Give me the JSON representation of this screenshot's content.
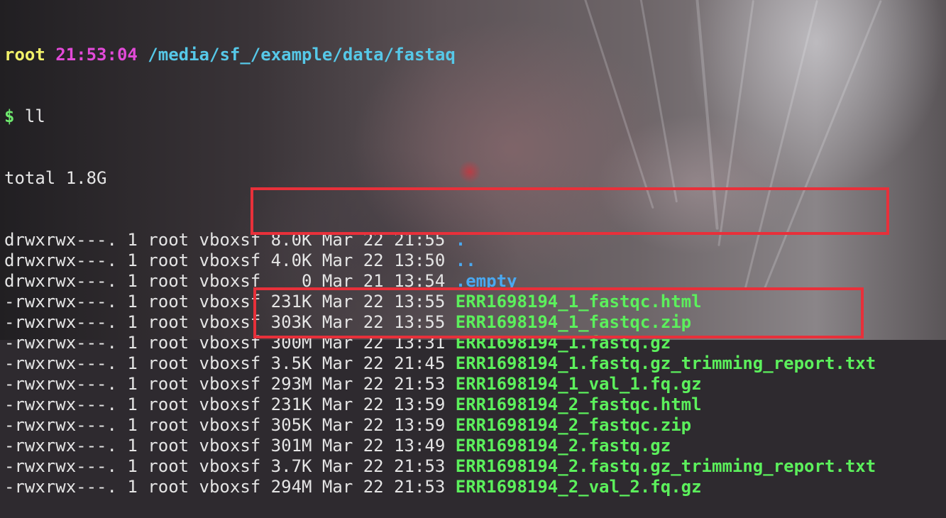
{
  "prompt": {
    "user": "root",
    "time": "21:53:04",
    "path": "/media/sf_/example/data/fastaq",
    "dollar": "$",
    "command": "ll"
  },
  "total_line": "total 1.8G",
  "entries": [
    {
      "meta": "drwxrwx---. 1 root vboxsf 8.0K Mar 22 21:55 ",
      "name": ".",
      "kind": "dir"
    },
    {
      "meta": "drwxrwx---. 1 root vboxsf 4.0K Mar 22 13:50 ",
      "name": "..",
      "kind": "dir"
    },
    {
      "meta": "drwxrwx---. 1 root vboxsf    0 Mar 21 13:54 ",
      "name": ".empty",
      "kind": "dir"
    },
    {
      "meta": "-rwxrwx---. 1 root vboxsf 231K Mar 22 13:55 ",
      "name": "ERR1698194_1_fastqc.html",
      "kind": "file"
    },
    {
      "meta": "-rwxrwx---. 1 root vboxsf 303K Mar 22 13:55 ",
      "name": "ERR1698194_1_fastqc.zip",
      "kind": "file"
    },
    {
      "meta": "-rwxrwx---. 1 root vboxsf 300M Mar 22 13:31 ",
      "name": "ERR1698194_1.fastq.gz",
      "kind": "file"
    },
    {
      "meta": "-rwxrwx---. 1 root vboxsf 3.5K Mar 22 21:45 ",
      "name": "ERR1698194_1.fastq.gz_trimming_report.txt",
      "kind": "file"
    },
    {
      "meta": "-rwxrwx---. 1 root vboxsf 293M Mar 22 21:53 ",
      "name": "ERR1698194_1_val_1.fq.gz",
      "kind": "file"
    },
    {
      "meta": "-rwxrwx---. 1 root vboxsf 231K Mar 22 13:59 ",
      "name": "ERR1698194_2_fastqc.html",
      "kind": "file"
    },
    {
      "meta": "-rwxrwx---. 1 root vboxsf 305K Mar 22 13:59 ",
      "name": "ERR1698194_2_fastqc.zip",
      "kind": "file"
    },
    {
      "meta": "-rwxrwx---. 1 root vboxsf 301M Mar 22 13:49 ",
      "name": "ERR1698194_2.fastq.gz",
      "kind": "file"
    },
    {
      "meta": "-rwxrwx---. 1 root vboxsf 3.7K Mar 22 21:53 ",
      "name": "ERR1698194_2.fastq.gz_trimming_report.txt",
      "kind": "file"
    },
    {
      "meta": "-rwxrwx---. 1 root vboxsf 294M Mar 22 21:53 ",
      "name": "ERR1698194_2_val_2.fq.gz",
      "kind": "file"
    }
  ],
  "highlight_color": "#e8303a",
  "colors": {
    "user": "#f2f26a",
    "time": "#e24ad8",
    "path": "#56c8e8",
    "dir": "#4aa8f0",
    "file": "#5cf05c",
    "text": "#e5e5e5"
  }
}
